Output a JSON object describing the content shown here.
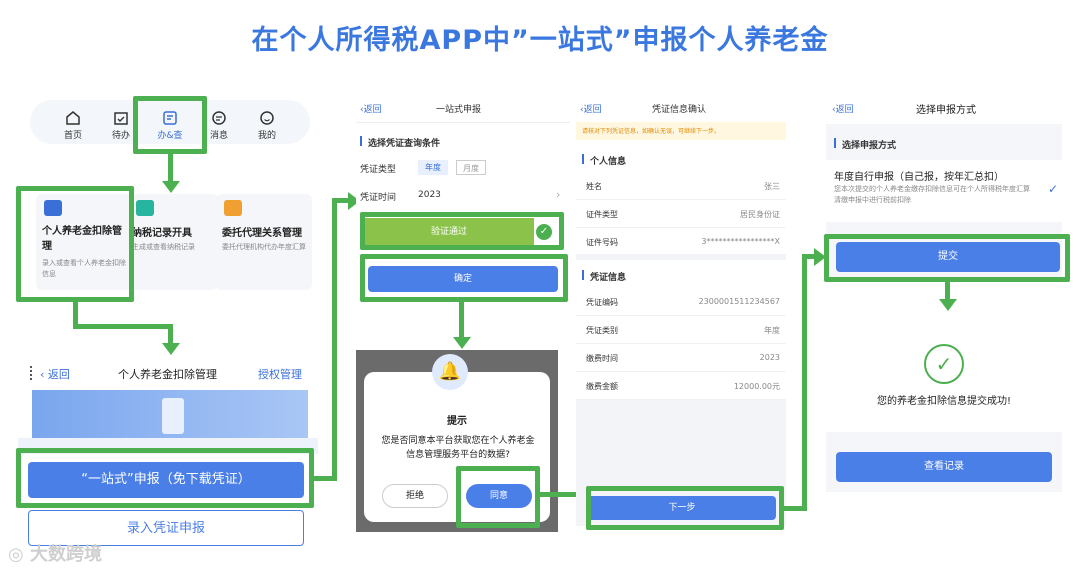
{
  "title": "在个人所得税APP中”一站式”申报个人养老金",
  "panel1": {
    "tabs": [
      "首页",
      "待办",
      "办&查",
      "消息",
      "我的"
    ],
    "cards": [
      {
        "title": "个人养老金扣除管理",
        "desc": "录入或查看个人养老金扣除信息"
      },
      {
        "title": "纳税记录开具",
        "desc": "生成或查看纳税记录"
      },
      {
        "title": "委托代理关系管理",
        "desc": "委托代理机构代办年度汇算"
      }
    ],
    "back": "返回",
    "page_title": "个人养老金扣除管理",
    "auth": "授权管理",
    "one_stop_btn": "“一站式”申报（免下载凭证）",
    "enter_btn": "录入凭证申报"
  },
  "panel2": {
    "back": "返回",
    "page_title": "一站式申报",
    "section": "选择凭证查询条件",
    "type_label": "凭证类型",
    "type_opt1": "年度",
    "type_opt2": "月度",
    "time_label": "凭证时间",
    "time_value": "2023",
    "verify": "验证通过",
    "confirm": "确定",
    "dialog_title": "提示",
    "dialog_text": "您是否同意本平台获取您在个人养老金信息管理服务平台的数据?",
    "reject": "拒绝",
    "agree": "同意"
  },
  "panel3": {
    "back": "返回",
    "page_title": "凭证信息确认",
    "notice": "请核对下列凭证信息，如确认无误，可继续下一步。",
    "section1": "个人信息",
    "rows1": [
      {
        "k": "姓名",
        "v": "张三"
      },
      {
        "k": "证件类型",
        "v": "居民身份证"
      },
      {
        "k": "证件号码",
        "v": "3*****************X"
      }
    ],
    "section2": "凭证信息",
    "rows2": [
      {
        "k": "凭证编码",
        "v": "2300001511234567"
      },
      {
        "k": "凭证类别",
        "v": "年度"
      },
      {
        "k": "缴费时间",
        "v": "2023"
      },
      {
        "k": "缴费金额",
        "v": "12000.00元"
      }
    ],
    "next": "下一步"
  },
  "panel4": {
    "back": "返回",
    "page_title": "选择申报方式",
    "section": "选择申报方式",
    "option_title": "年度自行申报（自己报，按年汇总扣）",
    "option_desc": "您本次提交的个人养老金缴存扣除信息可在个人所得税年度汇算清缴申报中进行税前扣除",
    "submit": "提交",
    "success": "您的养老金扣除信息提交成功!",
    "view": "查看记录"
  },
  "watermark": "大数跨境",
  "colors": {
    "accent": "#4b7fe8",
    "green": "#4caf50",
    "title": "#3a78e0"
  }
}
